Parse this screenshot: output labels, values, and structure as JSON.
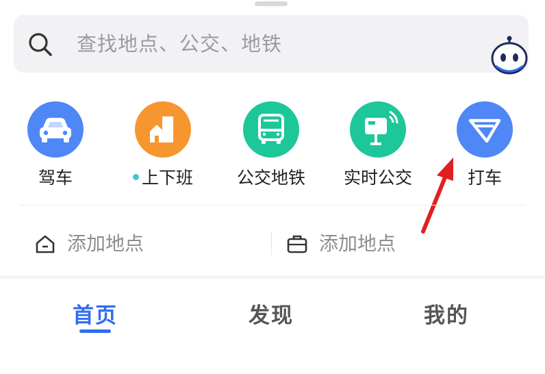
{
  "search": {
    "placeholder": "查找地点、公交、地铁"
  },
  "actions": [
    {
      "label": "驾车",
      "icon": "car-icon",
      "color": "#4f87f6"
    },
    {
      "label": "上下班",
      "icon": "commute-icon",
      "color": "#f7962e",
      "has_dot": true
    },
    {
      "label": "公交地铁",
      "icon": "bus-icon",
      "color": "#1dc79a"
    },
    {
      "label": "实时公交",
      "icon": "realtime-bus-stop-icon",
      "color": "#1dc79a"
    },
    {
      "label": "打车",
      "icon": "taxi-icon",
      "color": "#4f87f6"
    }
  ],
  "places": {
    "home": {
      "label": "添加地点",
      "icon": "home-icon"
    },
    "work": {
      "label": "添加地点",
      "icon": "briefcase-icon"
    }
  },
  "tabs": [
    {
      "label": "首页",
      "active": true
    },
    {
      "label": "发现",
      "active": false
    },
    {
      "label": "我的",
      "active": false
    }
  ],
  "colors": {
    "accent": "#2f6df0",
    "annotation_arrow": "#e02020"
  }
}
